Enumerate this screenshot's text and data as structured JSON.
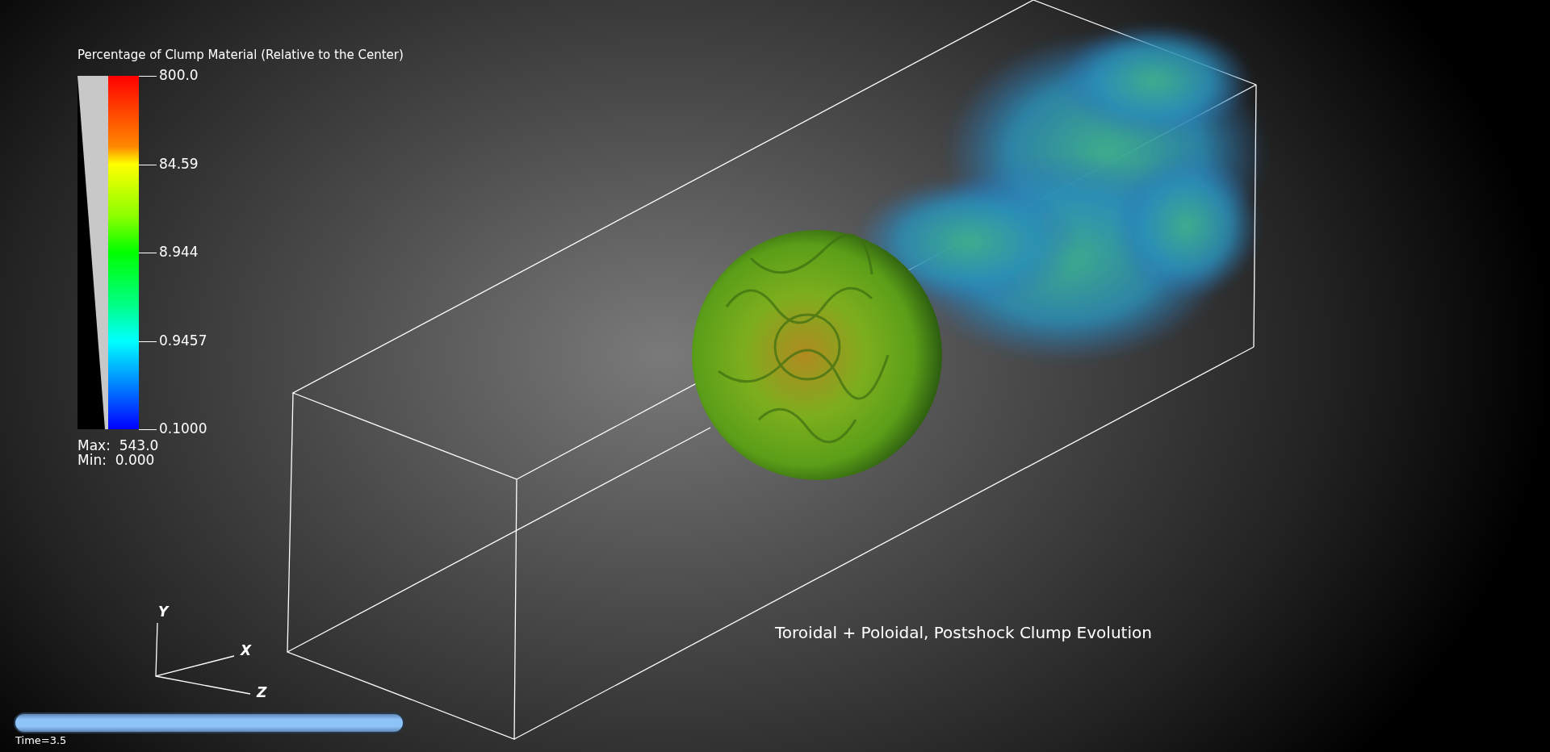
{
  "legend": {
    "title": "Percentage of Clump Material (Relative to the Center)",
    "ticks": [
      "800.0",
      "84.59",
      "8.944",
      "0.9457",
      "0.1000"
    ],
    "max": "Max:  543.0",
    "min": "Min:  0.000"
  },
  "axes_triad": {
    "labels": [
      "Y",
      "X",
      "Z"
    ]
  },
  "plot_title": "Toroidal + Poloidal, Postshock Clump Evolution",
  "time_slider": {
    "level": 1,
    "label": "Time=3.5"
  }
}
